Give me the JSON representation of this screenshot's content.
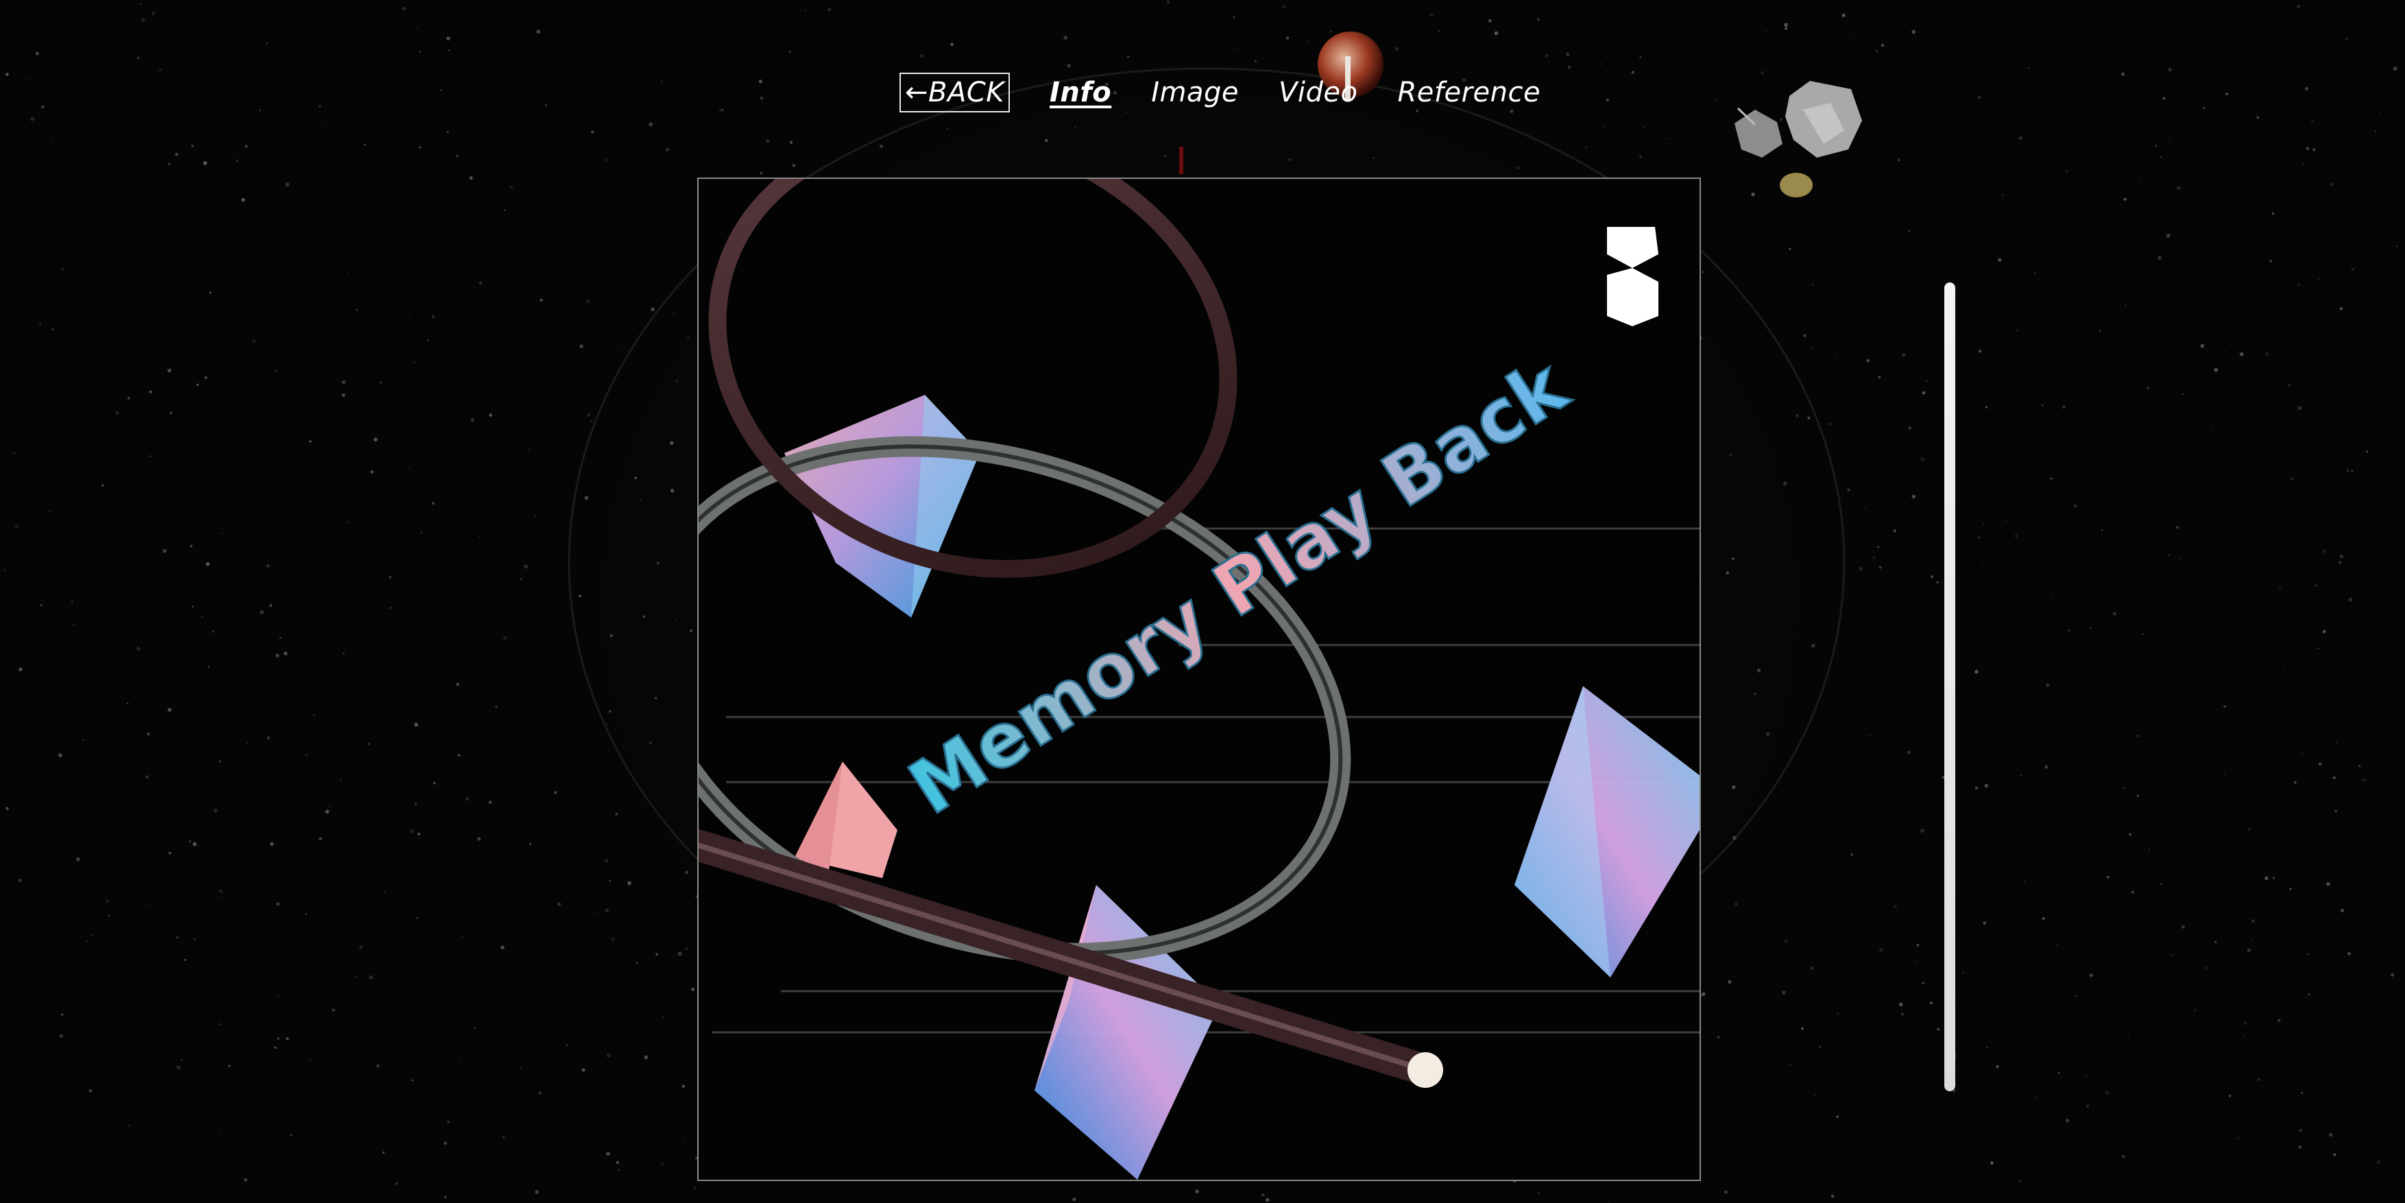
{
  "nav": {
    "back_label": "←BACK",
    "items": [
      "Info",
      "Image",
      "Video",
      "Reference"
    ],
    "active": "Info"
  },
  "artwork": {
    "text": "Memory Play Back"
  },
  "colors": {
    "background": "#050505",
    "nav_text": "#ffffff",
    "crystal_blue": "#3fb6f0",
    "crystal_pink": "#f4a7b6",
    "ring_dark": "#3a2326",
    "ring_gray": "#6d7270"
  },
  "icons": [
    "planet-icon",
    "asteroid-icon",
    "logo-mark-icon"
  ]
}
